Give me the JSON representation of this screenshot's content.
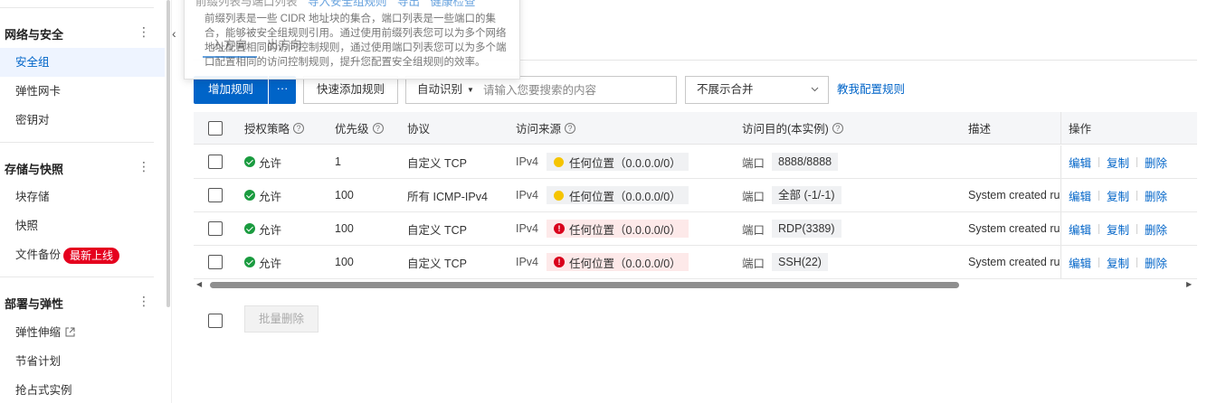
{
  "sidebar": {
    "groups": [
      {
        "title": "网络与安全",
        "items": [
          {
            "label": "安全组",
            "active": true
          },
          {
            "label": "弹性网卡"
          },
          {
            "label": "密钥对"
          }
        ]
      },
      {
        "title": "存储与快照",
        "items": [
          {
            "label": "块存储"
          },
          {
            "label": "快照"
          },
          {
            "label": "文件备份",
            "badge": "最新上线"
          }
        ]
      },
      {
        "title": "部署与弹性",
        "items": [
          {
            "label": "弹性伸缩",
            "external": true
          },
          {
            "label": "节省计划"
          },
          {
            "label": "抢占式实例"
          }
        ]
      }
    ]
  },
  "popover": {
    "title": "前缀列表与端口列表",
    "import_link": "导入安全组规则",
    "export_link": "导出",
    "health_link": "健康检查",
    "body": "前缀列表是一些 CIDR 地址块的集合，端口列表是一些端口的集合，能够被安全组规则引用。通过使用前缀列表您可以为多个网络地址配置相同的访问控制规则，通过使用端口列表您可以为多个端口配置相同的访问控制规则，提升您配置安全组规则的效率。",
    "tabs": [
      "入方向",
      "出方向"
    ]
  },
  "toolbar": {
    "add_rule": "增加规则",
    "more": "···",
    "quick_add": "快速添加规则",
    "search_mode": "自动识别",
    "search_placeholder": "请输入您要搜索的内容",
    "merge_select": "不展示合并",
    "help_link": "教我配置规则"
  },
  "table": {
    "headers": {
      "policy": "授权策略",
      "priority": "优先级",
      "protocol": "协议",
      "source": "访问来源",
      "dest": "访问目的(本实例)",
      "desc": "描述",
      "ops": "操作"
    },
    "rows": [
      {
        "policy": "允许",
        "priority": "1",
        "protocol": "自定义 TCP",
        "ip": "IPv4",
        "source": "任何位置（0.0.0.0/0）",
        "level": "warn",
        "port_label": "端口",
        "port": "8888/8888",
        "desc": ""
      },
      {
        "policy": "允许",
        "priority": "100",
        "protocol": "所有 ICMP-IPv4",
        "ip": "IPv4",
        "source": "任何位置（0.0.0.0/0）",
        "level": "warn",
        "port_label": "端口",
        "port": "全部 (-1/-1)",
        "desc": "System created rule."
      },
      {
        "policy": "允许",
        "priority": "100",
        "protocol": "自定义 TCP",
        "ip": "IPv4",
        "source": "任何位置（0.0.0.0/0）",
        "level": "danger",
        "port_label": "端口",
        "port": "RDP(3389)",
        "desc": "System created rule."
      },
      {
        "policy": "允许",
        "priority": "100",
        "protocol": "自定义 TCP",
        "ip": "IPv4",
        "source": "任何位置（0.0.0.0/0）",
        "level": "danger",
        "port_label": "端口",
        "port": "SSH(22)",
        "desc": "System created rule."
      }
    ],
    "ops": {
      "edit": "编辑",
      "copy": "复制",
      "delete": "删除"
    }
  },
  "footer": {
    "bulk_delete": "批量删除"
  },
  "colors": {
    "accent": "#0064c8",
    "allow": "#1a9b3f",
    "warn": "#f5c400",
    "danger": "#d9001b",
    "badge": "#e5001e"
  }
}
